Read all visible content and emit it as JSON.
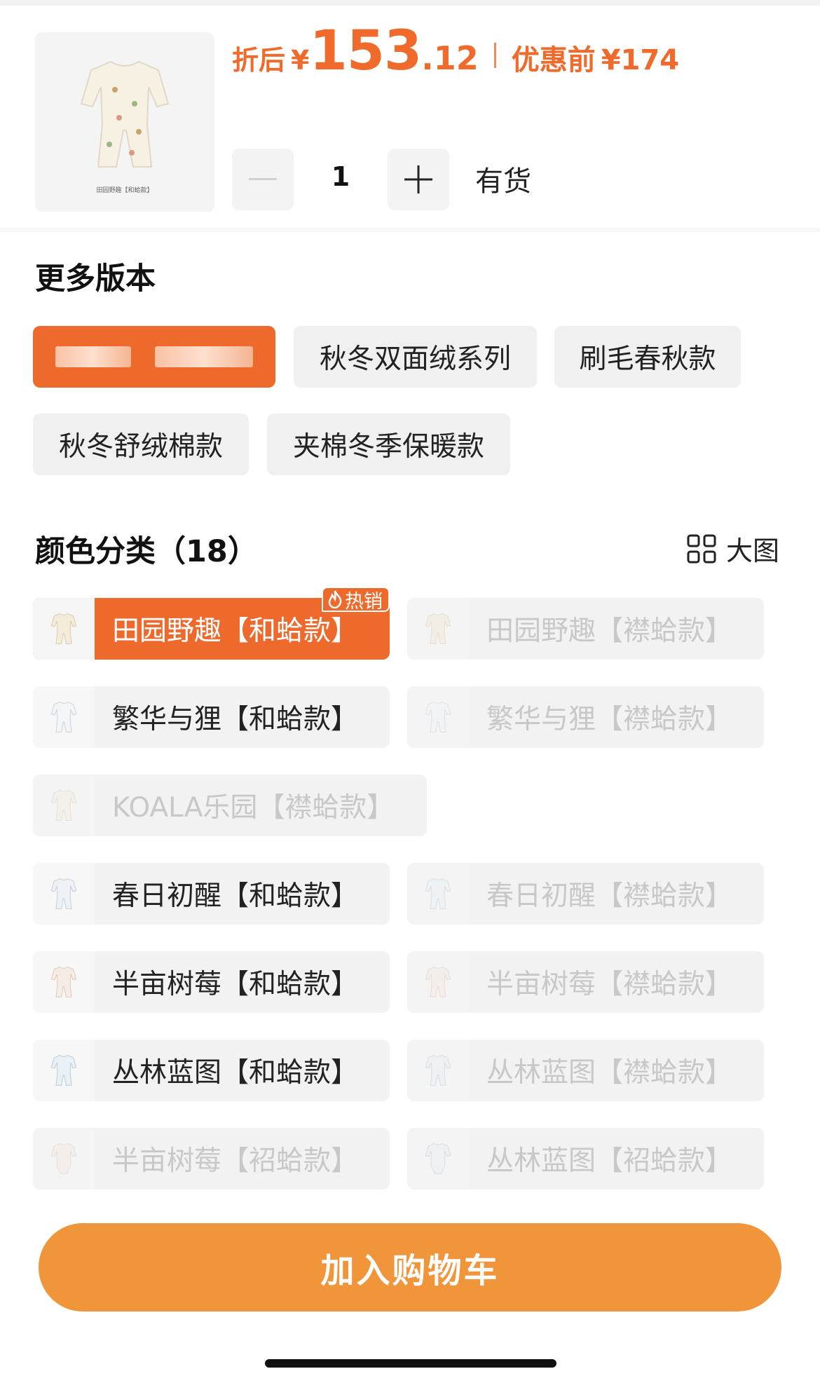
{
  "product": {
    "thumb_caption": "田园野趣【和蛤款】",
    "price_label": "折后",
    "currency": "¥",
    "price_integer": "153",
    "price_decimal": ".12",
    "original_price_label": "优惠前",
    "original_price": "174",
    "quantity": "1",
    "stock_status": "有货",
    "accent_color": "#ee6a2c"
  },
  "versions": {
    "title": "更多版本",
    "options": [
      {
        "label": "",
        "selected": true,
        "obscured": true
      },
      {
        "label": "秋冬双面绒系列",
        "selected": false
      },
      {
        "label": "刷毛春秋款",
        "selected": false
      },
      {
        "label": "秋冬舒绒棉款",
        "selected": false
      },
      {
        "label": "夹棉冬季保暖款",
        "selected": false
      }
    ]
  },
  "colors": {
    "title": "颜色分类（18）",
    "view_toggle_label": "大图",
    "hot_badge": "热销",
    "items": [
      {
        "label": "田园野趣【和蛤款】",
        "selected": true,
        "available": true
      },
      {
        "label": "田园野趣【襟蛤款】",
        "selected": false,
        "available": false
      },
      {
        "label": "繁华与狸【和蛤款】",
        "selected": false,
        "available": true
      },
      {
        "label": "繁华与狸【襟蛤款】",
        "selected": false,
        "available": false
      },
      {
        "label": "KOALA乐园【襟蛤款】",
        "selected": false,
        "available": false
      },
      {
        "label": "春日初醒【和蛤款】",
        "selected": false,
        "available": true
      },
      {
        "label": "春日初醒【襟蛤款】",
        "selected": false,
        "available": false
      },
      {
        "label": "半亩树莓【和蛤款】",
        "selected": false,
        "available": true
      },
      {
        "label": "半亩树莓【襟蛤款】",
        "selected": false,
        "available": false
      },
      {
        "label": "丛林蓝图【和蛤款】",
        "selected": false,
        "available": true
      },
      {
        "label": "丛林蓝图【襟蛤款】",
        "selected": false,
        "available": false
      },
      {
        "label": "半亩树莓【袑蛤款】",
        "selected": false,
        "available": false
      },
      {
        "label": "丛林蓝图【袑蛤款】",
        "selected": false,
        "available": false
      }
    ]
  },
  "cart": {
    "add_to_cart_label": "加入购物车",
    "button_color": "#f1953b"
  }
}
